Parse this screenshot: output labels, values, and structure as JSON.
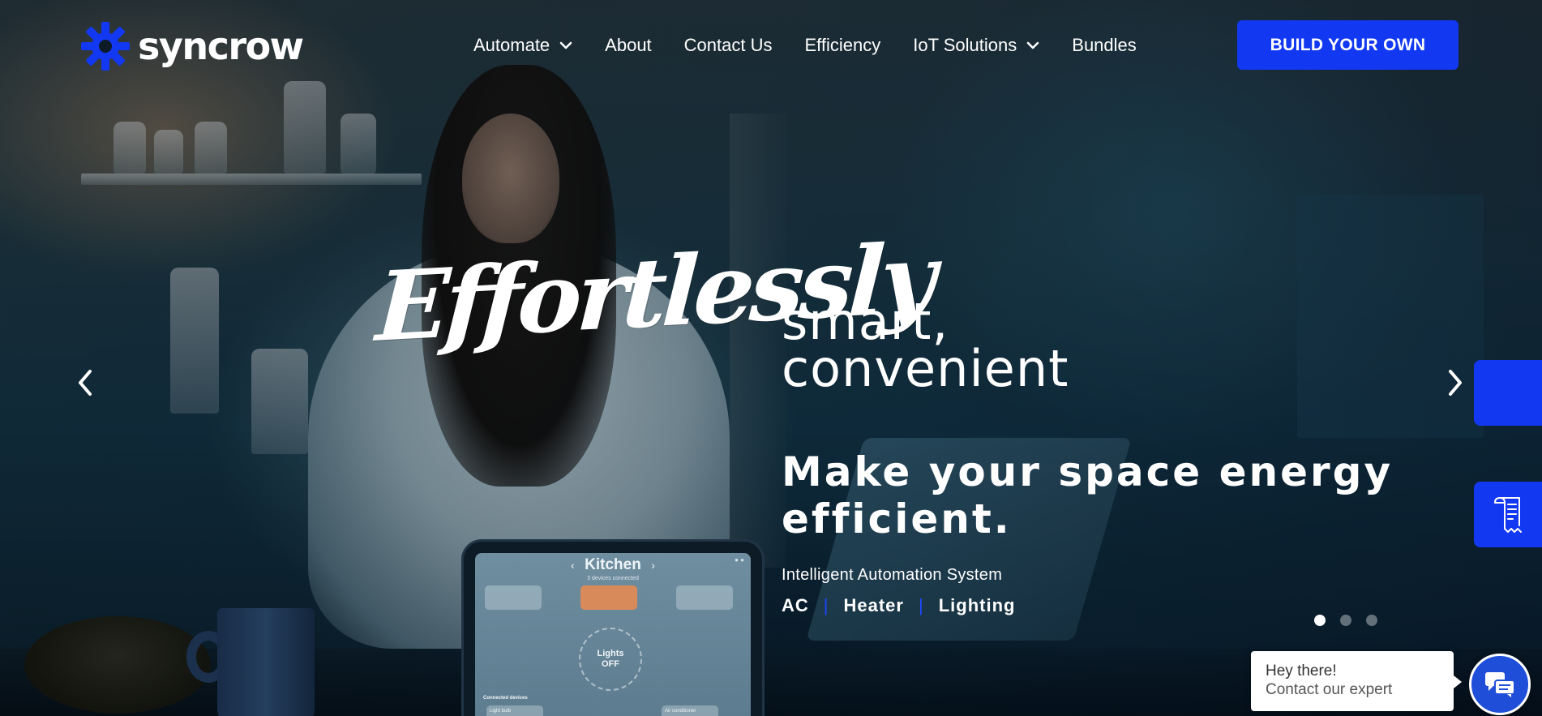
{
  "brand": {
    "name": "syncrow",
    "accent_color": "#1238f1",
    "logo_icon": "gear-sun-logo-icon"
  },
  "nav": {
    "items": [
      {
        "label": "Automate",
        "has_dropdown": true
      },
      {
        "label": "About",
        "has_dropdown": false
      },
      {
        "label": "Contact Us",
        "has_dropdown": false
      },
      {
        "label": "Efficiency",
        "has_dropdown": false
      },
      {
        "label": "IoT Solutions",
        "has_dropdown": true
      },
      {
        "label": "Bundles",
        "has_dropdown": false
      }
    ],
    "cta_label": "BUILD YOUR OWN"
  },
  "hero": {
    "script_word": "Effortlessly",
    "heading_line1": "smart,",
    "heading_line2": "convenient",
    "subheading": "Make your space energy efficient.",
    "tagline": "Intelligent Automation System",
    "features": [
      "AC",
      "Heater",
      "Lighting"
    ],
    "feature_separator": "|"
  },
  "carousel": {
    "slide_count": 3,
    "active_index": 0,
    "prev_icon": "chevron-left-icon",
    "next_icon": "chevron-right-icon"
  },
  "tablet_mockup": {
    "room_title": "Kitchen",
    "room_subtitle": "3 devices connected",
    "dial_line1": "Lights",
    "dial_line2": "OFF",
    "section_label": "Connected devices",
    "device1": "Light bulb",
    "device2": "Air conditioner"
  },
  "side_tabs": [
    {
      "icon": "blank-tab-icon"
    },
    {
      "icon": "receipt-document-icon"
    }
  ],
  "chat": {
    "title": "Hey there!",
    "subtitle": "Contact our expert",
    "icon": "chat-bubbles-icon"
  }
}
